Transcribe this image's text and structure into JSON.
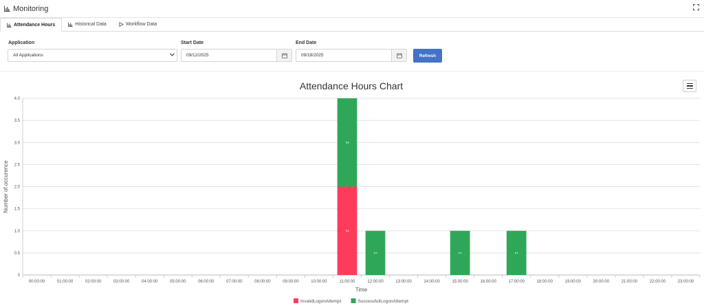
{
  "header": {
    "title": "Monitoring",
    "title_icon": "bar-chart-icon",
    "expand_icon": "expand-icon"
  },
  "tabs": [
    {
      "label": "Attendance Hours",
      "icon": "bar-chart-icon",
      "active": true
    },
    {
      "label": "Historical Data",
      "icon": "bar-chart-icon",
      "active": false
    },
    {
      "label": "Workflow Data",
      "icon": "play-icon",
      "active": false
    }
  ],
  "filters": {
    "application": {
      "label": "Application",
      "value": "All Applications"
    },
    "start_date": {
      "label": "Start Date",
      "value": "09/12/2025"
    },
    "end_date": {
      "label": "End Date",
      "value": "09/18/2025"
    },
    "refresh_label": "Refresh"
  },
  "chart_data": {
    "type": "bar",
    "stacked": true,
    "title": "Attendance Hours Chart",
    "xlabel": "Time",
    "ylabel": "Number of occurence",
    "ylim": [
      0,
      4
    ],
    "yticks": [
      "0",
      "0.5",
      "1.0",
      "1.5",
      "2.0",
      "2.5",
      "3.0",
      "3.5",
      "4.0"
    ],
    "categories": [
      "00:00:00",
      "01:00:00",
      "02:00:00",
      "03:00:00",
      "04:00:00",
      "05:00:00",
      "06:00:00",
      "07:00:00",
      "08:00:00",
      "09:00:00",
      "10:00:00",
      "11:00:00",
      "12:00:00",
      "13:00:00",
      "14:00:00",
      "15:00:00",
      "16:00:00",
      "17:00:00",
      "18:00:00",
      "19:00:00",
      "20:00:00",
      "21:00:00",
      "22:00:00",
      "23:00:00"
    ],
    "series": [
      {
        "name": "InvalidLogonAttempt",
        "color": "#ff3b5c",
        "values": [
          0,
          0,
          0,
          0,
          0,
          0,
          0,
          0,
          0,
          0,
          0,
          2,
          0,
          0,
          0,
          0,
          0,
          0,
          0,
          0,
          0,
          0,
          0,
          0
        ]
      },
      {
        "name": "SuccessfullLogonAttempt",
        "color": "#2ea858",
        "values": [
          0,
          0,
          0,
          0,
          0,
          0,
          0,
          0,
          0,
          0,
          0,
          2,
          1,
          0,
          0,
          1,
          0,
          1,
          0,
          0,
          0,
          0,
          0,
          0
        ]
      }
    ],
    "grid": true,
    "legend": "bottom-center"
  }
}
